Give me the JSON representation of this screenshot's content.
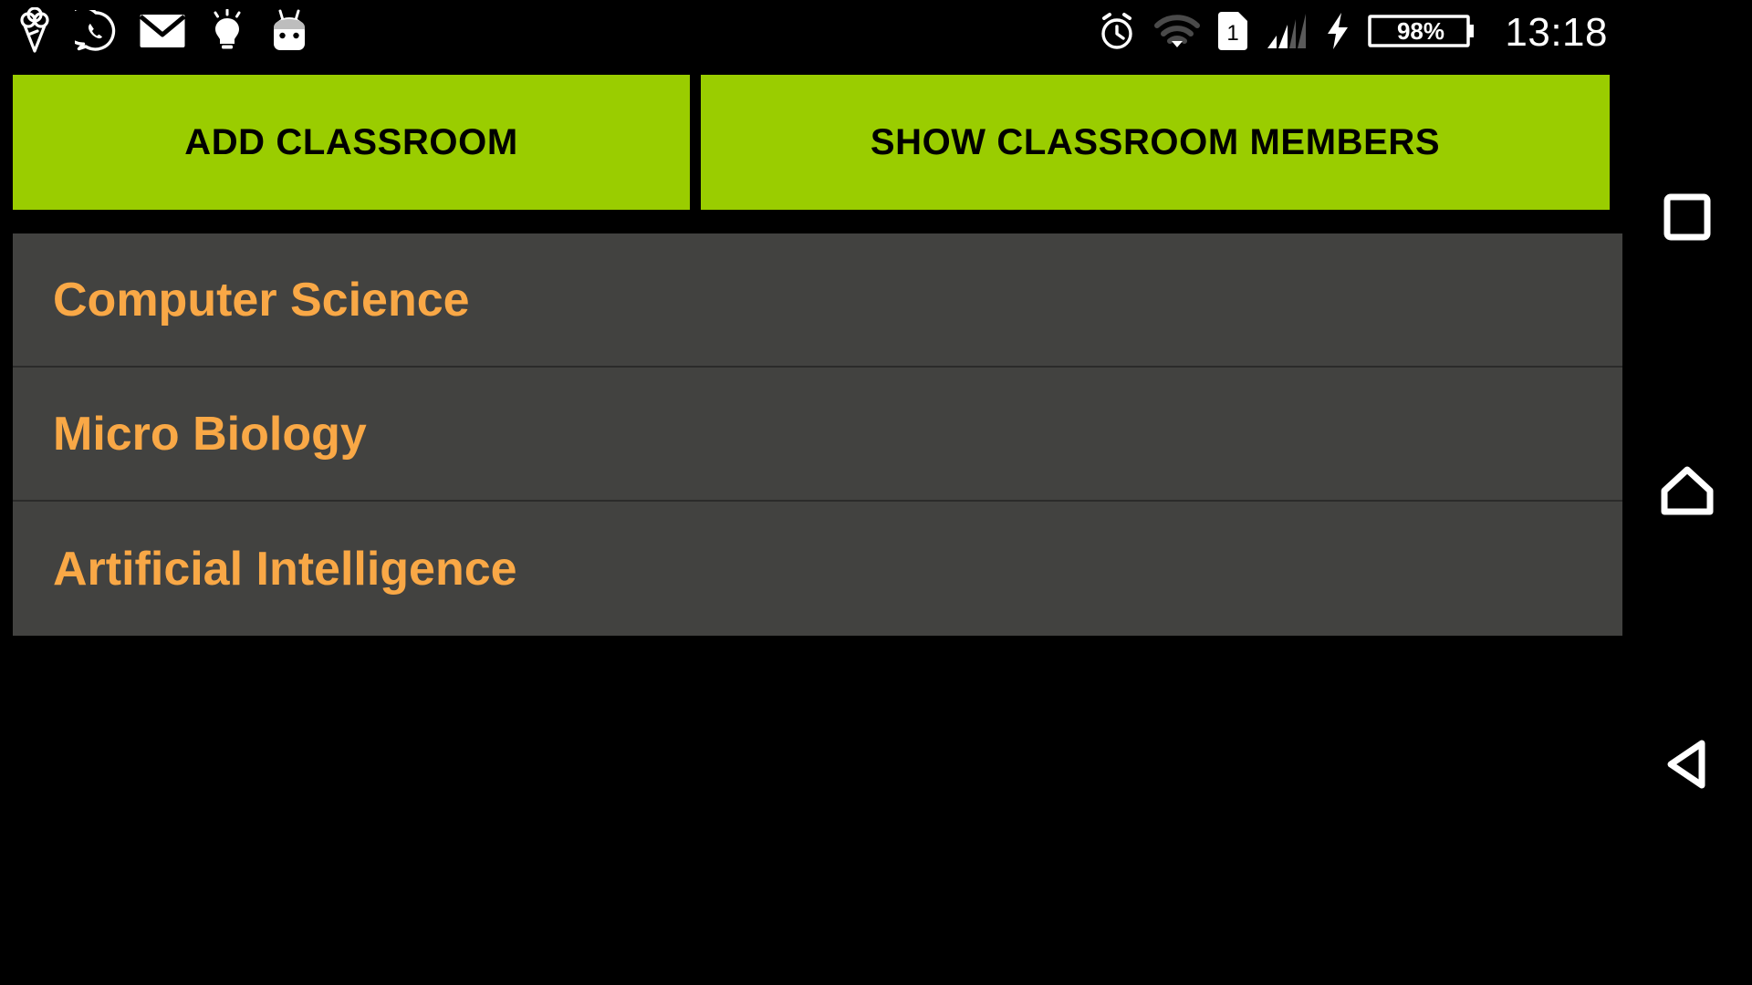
{
  "status_bar": {
    "notification_icons": [
      {
        "name": "ice-cream-icon",
        "label": "Ice cream"
      },
      {
        "name": "whatsapp-icon",
        "label": "WhatsApp"
      },
      {
        "name": "email-icon",
        "label": "Email"
      },
      {
        "name": "lightbulb-icon",
        "label": "Tip"
      },
      {
        "name": "android-marshmallow-icon",
        "label": "Android"
      }
    ],
    "alarm_icon": "alarm-clock-icon",
    "wifi_icon": "wifi-icon",
    "sim_icon_label": "1",
    "signal_icon": "cellular-signal-icon",
    "charging_icon": "charging-bolt-icon",
    "battery_percent": "98%",
    "clock": "13:18"
  },
  "toolbar": {
    "add_classroom_label": "ADD CLASSROOM",
    "show_members_label": "SHOW CLASSROOM MEMBERS"
  },
  "classroom_list": {
    "items": [
      {
        "name": "Computer Science"
      },
      {
        "name": "Micro Biology"
      },
      {
        "name": "Artificial Intelligence"
      }
    ]
  },
  "nav_bar": {
    "recents_label": "Recents",
    "home_label": "Home",
    "back_label": "Back"
  },
  "colors": {
    "accent_green": "#9ACD00",
    "list_background": "#424240",
    "list_text": "#F9A846",
    "screen_background": "#000000"
  }
}
